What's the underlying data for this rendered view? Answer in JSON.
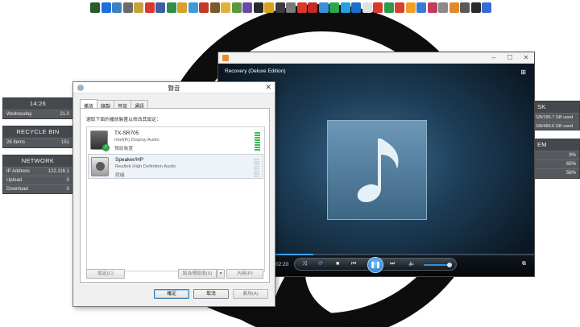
{
  "dock": {
    "icon_colors": [
      "#2a5a2e",
      "#1e6fd9",
      "#3b82c4",
      "#6a6a6a",
      "#c8a23a",
      "#d63a2a",
      "#3b5ea8",
      "#2f8f4a",
      "#d9a12c",
      "#3f9bd6",
      "#c23b2a",
      "#7a5a2a",
      "#e0b23a",
      "#5a9a3a",
      "#6a4aa8",
      "#2a2a2a",
      "#d6a21c",
      "#3b3b3b",
      "#7a7a7a",
      "#d63a2a",
      "#c22a2a",
      "#3f8fd6",
      "#2aa84a",
      "#22a0e0",
      "#1b6fc8",
      "#e0e0e0",
      "#d63a2a",
      "#2f9a4a",
      "#d9412a",
      "#f0a020",
      "#3a7ad6",
      "#c23b5a",
      "#8a8a8a",
      "#e08a2a",
      "#5a5a5a",
      "#2a2a2a",
      "#3a6ad6"
    ]
  },
  "gadgets": {
    "clock": {
      "time": "14:26",
      "day": "Wednesday",
      "date": "21.0"
    },
    "recycle": {
      "title": "RECYCLE BIN",
      "items": "26 Items",
      "size": "151"
    },
    "network": {
      "title": "NETWORK",
      "rows": [
        {
          "label": "IP Address",
          "value": "122.116.1"
        },
        {
          "label": "Upload",
          "value": "0"
        },
        {
          "label": "Download",
          "value": "0"
        }
      ]
    },
    "disk": {
      "title": "SK",
      "row1": "GB/195.7 GB used",
      "row2": "GB/489.6 GB used"
    },
    "system": {
      "title": "EM",
      "values": [
        "9%",
        "65%",
        "56%"
      ]
    }
  },
  "wmp": {
    "track": "Recovery (Deluxe Edition)",
    "time": "02:20",
    "progress": 0.3,
    "volume": 0.8,
    "icons": [
      "switch-view-icon",
      "shuffle-icon",
      "repeat-icon",
      "stop-icon",
      "previous-icon",
      "pause-icon",
      "next-icon",
      "volume-icon",
      "minimize-icon",
      "maximize-icon",
      "close-icon",
      "music-note-icon"
    ]
  },
  "sound": {
    "title": "聲音",
    "tabs": [
      "播放",
      "錄製",
      "音效",
      "通訊"
    ],
    "instruction": "選取下面的播放裝置以修改其設定：",
    "devices": [
      {
        "name": "TX-SR705",
        "driver": "Intel(R) Display Audio",
        "status": "預設裝置"
      },
      {
        "name": "Speaker/HP",
        "driver": "Realtek High Definition Audio",
        "status": "就緒"
      }
    ],
    "buttons": {
      "configure": "設定(C)",
      "set_default": "設為預設值(S)",
      "properties": "內容(P)",
      "ok": "確定",
      "cancel": "取消",
      "apply": "套用(A)"
    }
  }
}
